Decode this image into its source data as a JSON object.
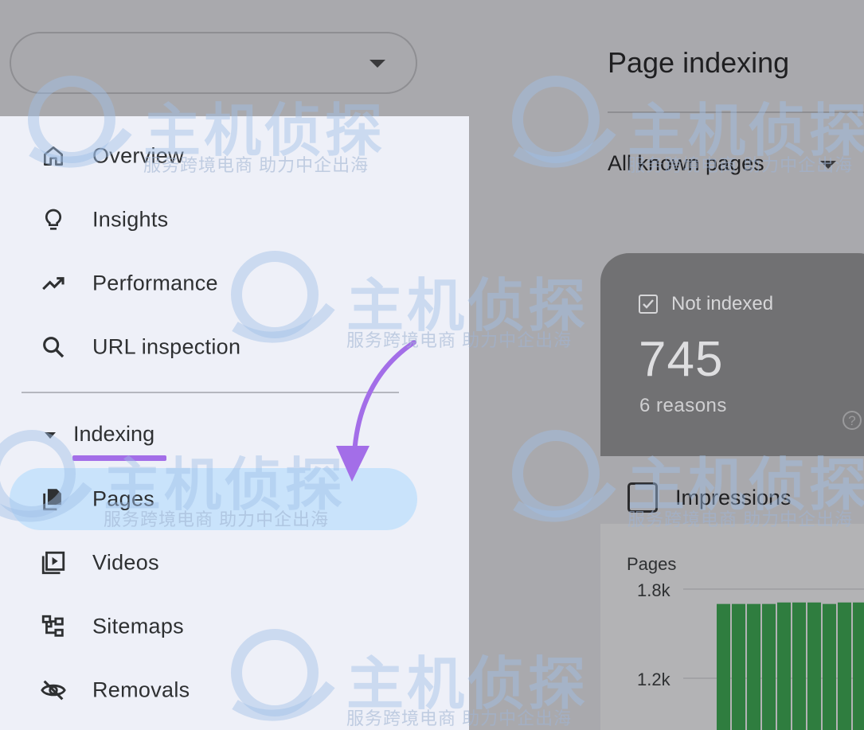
{
  "property_selector": {
    "value": ""
  },
  "sidebar": {
    "items": [
      {
        "label": "Overview",
        "icon": "home-icon"
      },
      {
        "label": "Insights",
        "icon": "lightbulb-icon"
      },
      {
        "label": "Performance",
        "icon": "trending-up-icon"
      },
      {
        "label": "URL inspection",
        "icon": "search-icon"
      }
    ],
    "section": {
      "label": "Indexing",
      "expanded": true
    },
    "sub_items": [
      {
        "label": "Pages",
        "icon": "pages-icon",
        "active": true
      },
      {
        "label": "Videos",
        "icon": "video-library-icon"
      },
      {
        "label": "Sitemaps",
        "icon": "sitemap-icon"
      },
      {
        "label": "Removals",
        "icon": "visibility-off-icon"
      }
    ]
  },
  "main": {
    "title": "Page indexing",
    "filter": {
      "value": "All known pages"
    },
    "card": {
      "checkbox_label": "Not indexed",
      "count": "745",
      "reasons": "6 reasons",
      "help": "?"
    },
    "impressions_label": "Impressions"
  },
  "chart_data": {
    "type": "bar",
    "ylabel": "Pages",
    "y_ticks": [
      "1.8k",
      "1.2k"
    ],
    "values": [
      1700,
      1700,
      1700,
      1700,
      1710,
      1710,
      1710,
      1700,
      1710,
      1710
    ],
    "color": "#2f7d3f"
  },
  "watermark": {
    "brand": "主机侦探",
    "slogan": "服务跨境电商 助力中企出海"
  },
  "colors": {
    "sidebar_bg": "#eef0f8",
    "active_pill": "#c9e3fb",
    "accent_underline": "#a36ee8",
    "arrow": "#a36ee8"
  }
}
